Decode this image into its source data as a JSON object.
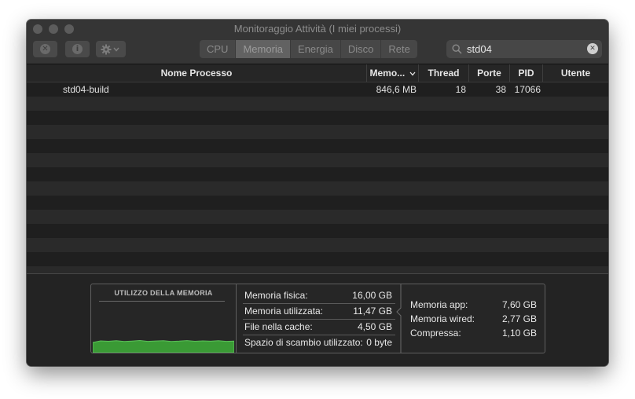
{
  "window": {
    "title": "Monitoraggio Attività (I miei processi)"
  },
  "toolbar": {
    "stop_icon": "x-circle-icon",
    "info_icon": "info-circle-icon",
    "gear_icon": "gear-icon",
    "tabs": [
      {
        "label": "CPU",
        "active": false
      },
      {
        "label": "Memoria",
        "active": true
      },
      {
        "label": "Energia",
        "active": false
      },
      {
        "label": "Disco",
        "active": false
      },
      {
        "label": "Rete",
        "active": false
      }
    ],
    "search": {
      "value": "std04",
      "placeholder": ""
    }
  },
  "table": {
    "columns": [
      "Nome Processo",
      "Memo...",
      "Thread",
      "Porte",
      "PID",
      "Utente"
    ],
    "rows": [
      {
        "name": "std04-build",
        "memory": "846,6 MB",
        "threads": "18",
        "ports": "38",
        "pid": "17066",
        "user": ""
      }
    ]
  },
  "memory": {
    "graph_title": "UTILIZZO DELLA MEMORIA",
    "pressure_level": 0.3,
    "stats_left": [
      {
        "label": "Memoria fisica:",
        "value": "16,00 GB"
      },
      {
        "label": "Memoria utilizzata:",
        "value": "11,47 GB"
      },
      {
        "label": "File nella cache:",
        "value": "4,50 GB"
      },
      {
        "label": "Spazio di scambio utilizzato:",
        "value": "0 byte"
      }
    ],
    "stats_right": [
      {
        "label": "Memoria app:",
        "value": "7,60 GB"
      },
      {
        "label": "Memoria wired:",
        "value": "2,77 GB"
      },
      {
        "label": "Compressa:",
        "value": "1,10 GB"
      }
    ]
  },
  "colors": {
    "pressure_green": "#3a9a35",
    "window_bg": "#1f1f1f",
    "row_alt": "#2a2a2a"
  }
}
